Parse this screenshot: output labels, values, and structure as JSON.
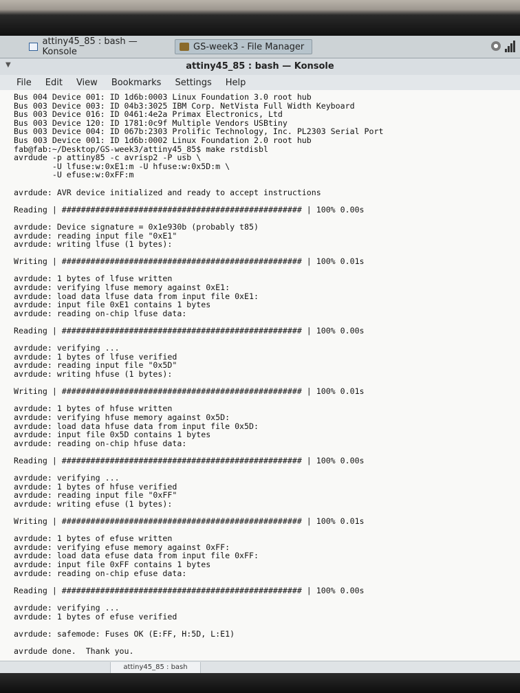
{
  "taskbar": {
    "tasks": [
      {
        "label": "attiny45_85 : bash — Konsole",
        "icon": "terminal-icon"
      },
      {
        "label": "GS-week3 - File Manager",
        "icon": "folder-icon"
      }
    ],
    "tray_icons": [
      "notification-icon",
      "signal-icon"
    ]
  },
  "window": {
    "title": "attiny45_85 : bash — Konsole",
    "menu": [
      "File",
      "Edit",
      "View",
      "Bookmarks",
      "Settings",
      "Help"
    ],
    "tab_label": "attiny45_85 : bash"
  },
  "terminal": {
    "lines": [
      "Bus 004 Device 001: ID 1d6b:0003 Linux Foundation 3.0 root hub",
      "Bus 003 Device 003: ID 04b3:3025 IBM Corp. NetVista Full Width Keyboard",
      "Bus 003 Device 016: ID 0461:4e2a Primax Electronics, Ltd",
      "Bus 003 Device 120: ID 1781:0c9f Multiple Vendors USBtiny",
      "Bus 003 Device 004: ID 067b:2303 Prolific Technology, Inc. PL2303 Serial Port",
      "Bus 003 Device 001: ID 1d6b:0002 Linux Foundation 2.0 root hub",
      "fab@fab:~/Desktop/GS-week3/attiny45_85$ make rstdisbl",
      "avrdude -p attiny85 -c avrisp2 -P usb \\",
      "        -U lfuse:w:0xE1:m -U hfuse:w:0x5D:m \\",
      "        -U efuse:w:0xFF:m",
      "",
      "avrdude: AVR device initialized and ready to accept instructions",
      "",
      "Reading | ################################################## | 100% 0.00s",
      "",
      "avrdude: Device signature = 0x1e930b (probably t85)",
      "avrdude: reading input file \"0xE1\"",
      "avrdude: writing lfuse (1 bytes):",
      "",
      "Writing | ################################################## | 100% 0.01s",
      "",
      "avrdude: 1 bytes of lfuse written",
      "avrdude: verifying lfuse memory against 0xE1:",
      "avrdude: load data lfuse data from input file 0xE1:",
      "avrdude: input file 0xE1 contains 1 bytes",
      "avrdude: reading on-chip lfuse data:",
      "",
      "Reading | ################################################## | 100% 0.00s",
      "",
      "avrdude: verifying ...",
      "avrdude: 1 bytes of lfuse verified",
      "avrdude: reading input file \"0x5D\"",
      "avrdude: writing hfuse (1 bytes):",
      "",
      "Writing | ################################################## | 100% 0.01s",
      "",
      "avrdude: 1 bytes of hfuse written",
      "avrdude: verifying hfuse memory against 0x5D:",
      "avrdude: load data hfuse data from input file 0x5D:",
      "avrdude: input file 0x5D contains 1 bytes",
      "avrdude: reading on-chip hfuse data:",
      "",
      "Reading | ################################################## | 100% 0.00s",
      "",
      "avrdude: verifying ...",
      "avrdude: 1 bytes of hfuse verified",
      "avrdude: reading input file \"0xFF\"",
      "avrdude: writing efuse (1 bytes):",
      "",
      "Writing | ################################################## | 100% 0.01s",
      "",
      "avrdude: 1 bytes of efuse written",
      "avrdude: verifying efuse memory against 0xFF:",
      "avrdude: load data efuse data from input file 0xFF:",
      "avrdude: input file 0xFF contains 1 bytes",
      "avrdude: reading on-chip efuse data:",
      "",
      "Reading | ################################################## | 100% 0.00s",
      "",
      "avrdude: verifying ...",
      "avrdude: 1 bytes of efuse verified",
      "",
      "avrdude: safemode: Fuses OK (E:FF, H:5D, L:E1)",
      "",
      "avrdude done.  Thank you.",
      ""
    ],
    "prompt": "fab@fab:~/Desktop/GS-week3/attiny45_85$ "
  }
}
